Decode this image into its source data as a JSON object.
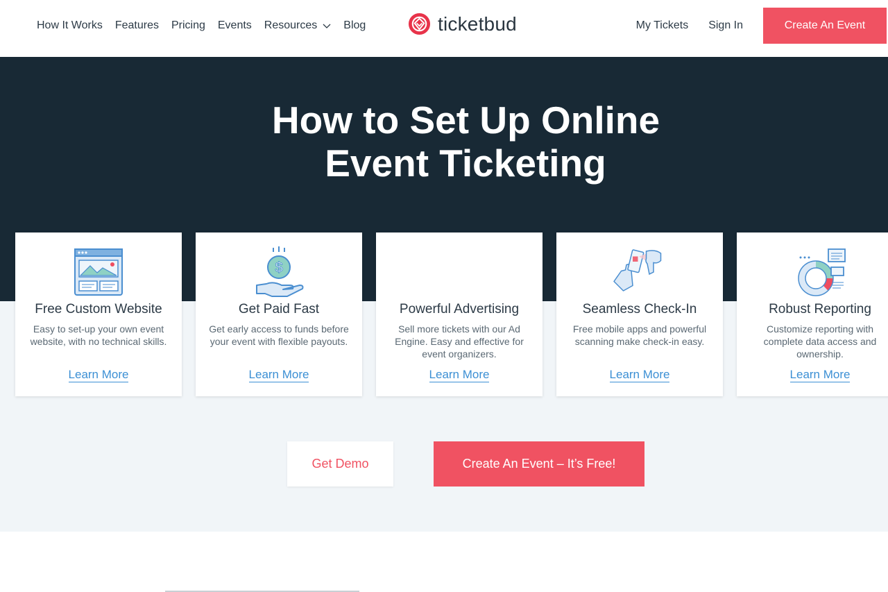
{
  "header": {
    "nav_left": [
      {
        "label": "How It Works"
      },
      {
        "label": "Features"
      },
      {
        "label": "Pricing"
      },
      {
        "label": "Events"
      },
      {
        "label": "Resources"
      },
      {
        "label": "Blog"
      }
    ],
    "logo_text": "ticketbud",
    "my_tickets": "My Tickets",
    "sign_in": "Sign In",
    "create_event": "Create An Event"
  },
  "hero": {
    "title_line1": "How to Set Up Online",
    "title_line2": "Event Ticketing"
  },
  "cards": [
    {
      "title": "Free Custom Website",
      "desc": "Easy to set-up your own event website, with no technical skills.",
      "link": "Learn More",
      "icon": "website-icon"
    },
    {
      "title": "Get Paid Fast",
      "desc": "Get early access to funds before your event with flexible payouts.",
      "link": "Learn More",
      "icon": "money-hand-icon"
    },
    {
      "title": "Powerful Advertising",
      "desc": "Sell more tickets with our Ad Engine. Easy and effective for event organizers.",
      "link": "Learn More",
      "icon": "advertising-icon"
    },
    {
      "title": "Seamless Check-In",
      "desc": "Free mobile apps and powerful scanning make check-in easy.",
      "link": "Learn More",
      "icon": "scanner-icon"
    },
    {
      "title": "Robust Reporting",
      "desc": "Customize reporting with complete data access and ownership.",
      "link": "Learn More",
      "icon": "reporting-icon"
    }
  ],
  "cta": {
    "demo": "Get Demo",
    "create": "Create An Event – It’s Free!"
  },
  "colors": {
    "accent": "#f05262",
    "hero_bg": "#182935",
    "link": "#3b8fd4",
    "band_bg": "#f1f5f8"
  }
}
